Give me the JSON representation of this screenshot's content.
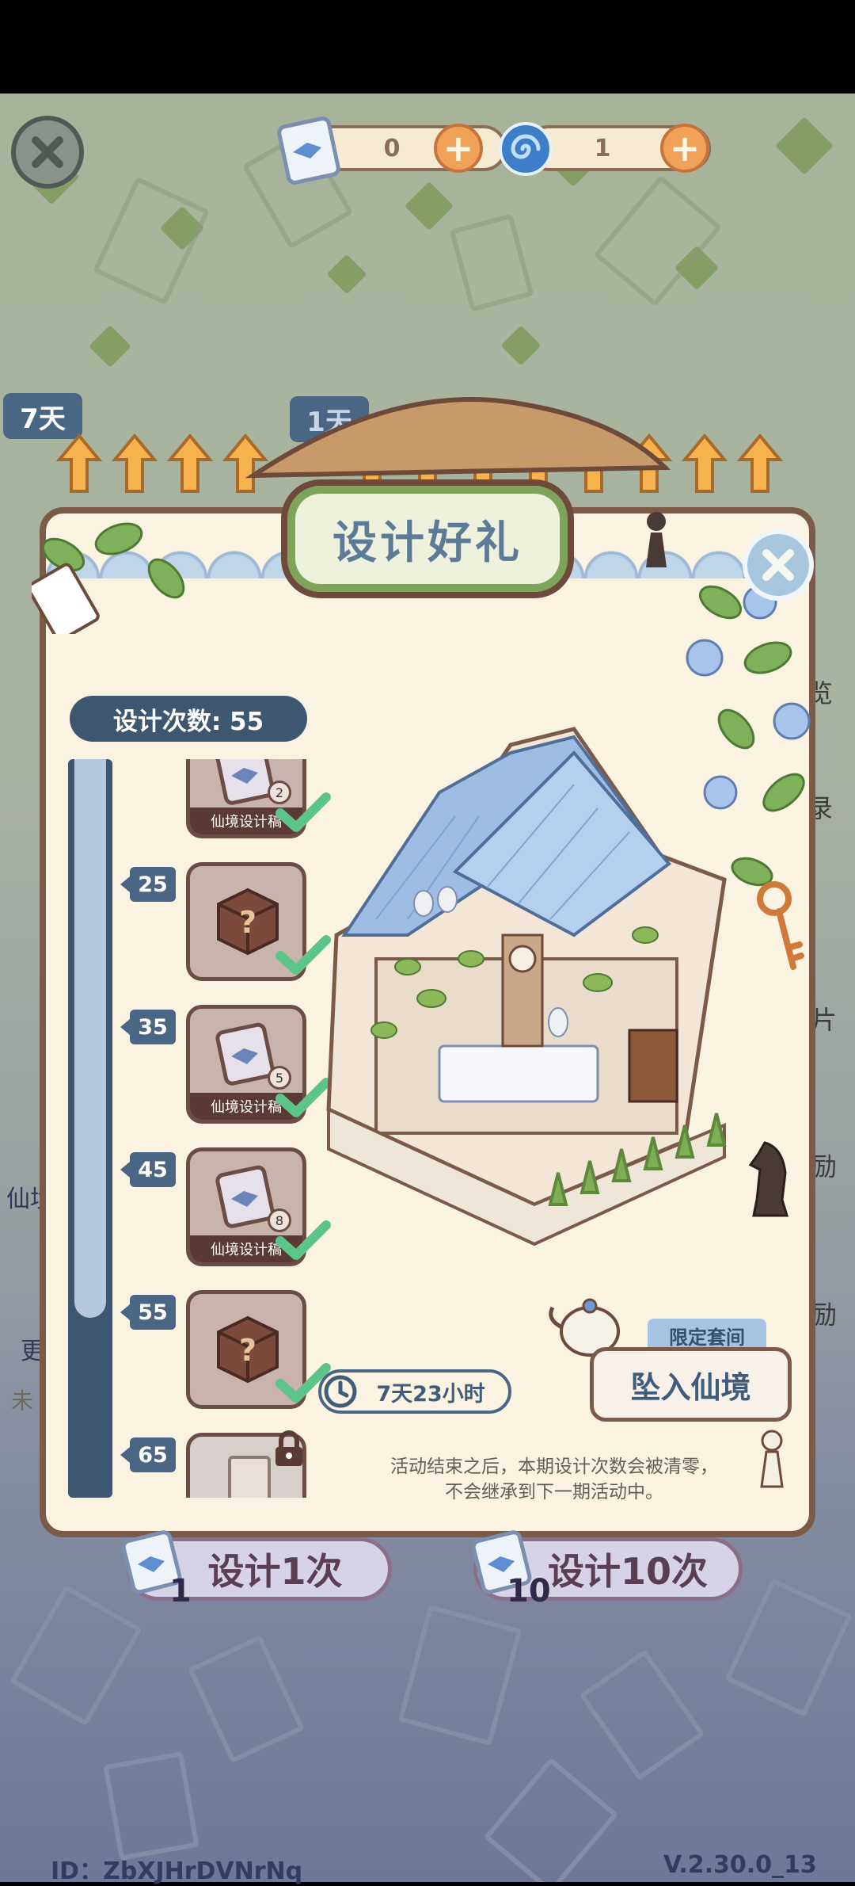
{
  "top_bar": {
    "scroll_count": "0",
    "swirl_count": "1"
  },
  "side_tabs": {
    "tab_left": "7天",
    "tab_right": "1天"
  },
  "dialog": {
    "title": "设计好礼",
    "design_count_label": "设计次数: 55",
    "timer": "7天23小时",
    "limited_tag": "限定套间",
    "enter_button": "坠入仙境",
    "notice_line1": "活动结束之后，本期设计次数会被清零，",
    "notice_line2": "不会继承到下一期活动中。",
    "milestones": [
      {
        "value": "",
        "reward_label": "仙境设计稿",
        "qty": "2",
        "claimed": true,
        "type": "scroll"
      },
      {
        "value": "25",
        "reward_label": "",
        "qty": "",
        "claimed": true,
        "type": "mystery"
      },
      {
        "value": "35",
        "reward_label": "仙境设计稿",
        "qty": "5",
        "claimed": true,
        "type": "scroll"
      },
      {
        "value": "45",
        "reward_label": "仙境设计稿",
        "qty": "8",
        "claimed": true,
        "type": "scroll"
      },
      {
        "value": "55",
        "reward_label": "",
        "qty": "",
        "claimed": true,
        "type": "mystery"
      },
      {
        "value": "65",
        "reward_label": "",
        "qty": "",
        "claimed": false,
        "type": "locked"
      }
    ]
  },
  "background_fragments": {
    "right_1": "览",
    "right_2": "录",
    "right_3": "片",
    "right_4": "励",
    "right_5": "励",
    "left_1": "仙境",
    "left_2": "更",
    "left_3": "未"
  },
  "design_buttons": {
    "once_label": "设计1次",
    "once_cost": "1",
    "ten_label": "设计10次",
    "ten_cost": "10"
  },
  "footer": {
    "user_id": "ID：ZbXJHrDVNrNq",
    "version": "V.2.30.0_13"
  },
  "colors": {
    "dialog_bg": "#fbf3e2",
    "dialog_border": "#7b5a48",
    "accent_blue": "#3e5770",
    "check_green": "#5cc68a",
    "plus_orange": "#f0a358"
  }
}
